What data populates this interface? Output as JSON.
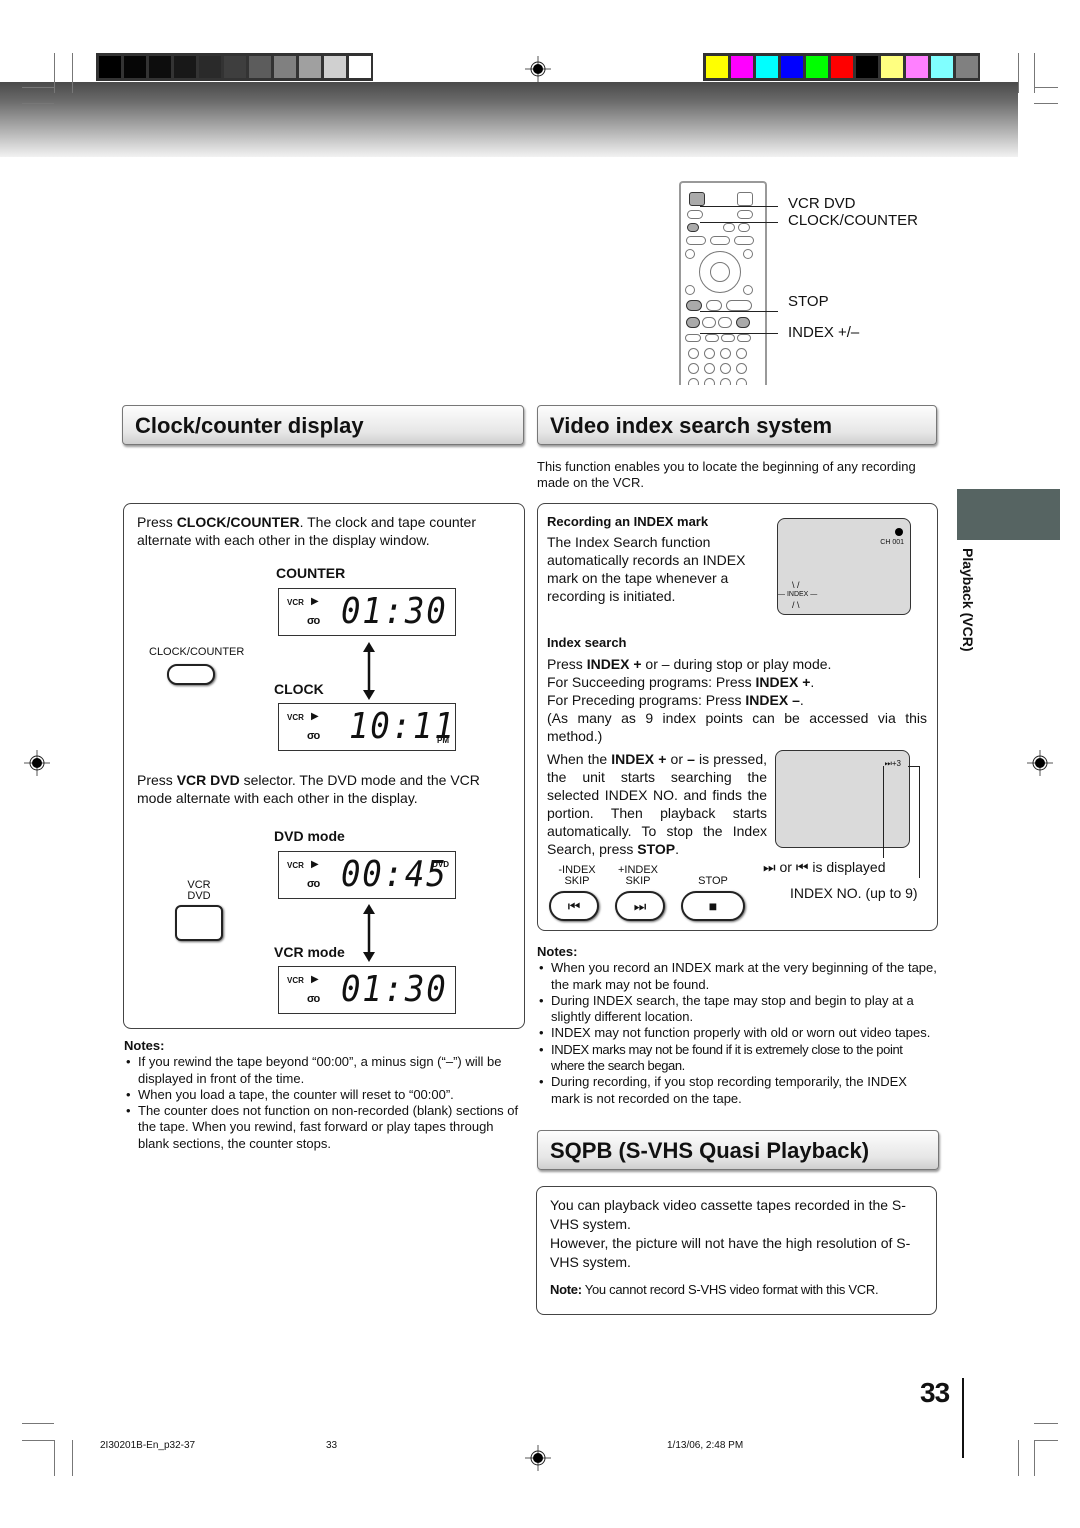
{
  "print_marks": {
    "grayscale_swatches": [
      "#000000",
      "#060606",
      "#0d0d0d",
      "#181818",
      "#2a2a2a",
      "#3e3e3e",
      "#5c5c5c",
      "#808080",
      "#a0a0a0",
      "#d0d0d0",
      "#ffffff"
    ],
    "color_swatches": [
      "#ffff00",
      "#ff00ff",
      "#00ffff",
      "#0000ff",
      "#00ff00",
      "#ff0000",
      "#000000",
      "#ffff80",
      "#ff80ff",
      "#80ffff",
      "#808080"
    ]
  },
  "remote": {
    "labels": [
      "VCR DVD",
      "CLOCK/COUNTER",
      "STOP",
      "INDEX +/–"
    ]
  },
  "clock_counter": {
    "title": "Clock/counter display",
    "intro_prefix": "Press ",
    "intro_bold": "CLOCK/COUNTER",
    "intro_suffix": ". The clock and tape counter alternate with each other in the display window.",
    "button_label": "CLOCK/COUNTER",
    "counter_label": "COUNTER",
    "clock_label": "CLOCK",
    "counter_display": {
      "source": "VCR",
      "digits": "01:30"
    },
    "clock_display": {
      "source": "VCR",
      "digits": "10:11",
      "suffix": "PM"
    },
    "selector_prefix": "Press ",
    "selector_bold": "VCR DVD",
    "selector_suffix": " selector. The DVD mode and the VCR mode alternate with each other in the display.",
    "vcrdvd_button_label_1": "VCR",
    "vcrdvd_button_label_2": "DVD",
    "dvd_mode_label": "DVD mode",
    "vcr_mode_label": "VCR mode",
    "dvd_display": {
      "source": "VCR",
      "digits": "00:45",
      "suffix": "DVD"
    },
    "vcr_display": {
      "source": "VCR",
      "digits": "01:30"
    },
    "notes_title": "Notes:",
    "notes": [
      "If you rewind the tape beyond “00:00”, a minus sign (“–”) will be displayed in front of the time.",
      "When you load a tape, the counter will reset to “00:00”.",
      "The counter does not function on non-recorded (blank) sections of the tape. When you rewind, fast forward or play tapes through blank sections, the counter stops."
    ]
  },
  "video_index": {
    "title": "Video index search system",
    "intro": "This function enables you to locate the beginning of any recording made on the VCR.",
    "recording_heading": "Recording an INDEX mark",
    "recording_text": "The Index Search function automatically records an INDEX mark on the tape whenever a recording is initiated.",
    "screen1": {
      "channel": "CH 001",
      "index_label": "INDEX"
    },
    "search_heading": "Index search",
    "search_line1_prefix": "Press ",
    "search_line1_bold": "INDEX +",
    "search_line1_suffix": " or – during stop or play mode.",
    "search_line2_prefix": "For Succeeding programs: Press ",
    "search_line2_bold": "INDEX +",
    "search_line3_prefix": "For Preceding programs: Press ",
    "search_line3_bold": "INDEX –",
    "search_line4": "(As many as 9 index points can be accessed via this method.)",
    "when_prefix": "When the ",
    "when_bold": "INDEX + ",
    "when_mid": "or ",
    "when_bold2": "–",
    "when_suffix": " is pressed, the unit starts searching the selected INDEX NO. and finds the portion. Then playback starts automatically. To stop the Index Search, press ",
    "when_bold3": "STOP",
    "screen2": {
      "index_indicator": "⏭+3"
    },
    "displayed_caption": "or ⏮ is displayed",
    "index_no_caption": "INDEX NO. (up to 9)",
    "buttons": [
      {
        "label_1": "-INDEX",
        "label_2": "SKIP",
        "glyph": "⏮"
      },
      {
        "label_1": "+INDEX",
        "label_2": "SKIP",
        "glyph": "⏭"
      },
      {
        "label_1": "",
        "label_2": "STOP",
        "glyph": "■"
      }
    ],
    "notes_title": "Notes:",
    "notes": [
      "When you record an INDEX mark at the very beginning of the tape, the mark may not be found.",
      "During INDEX search, the tape may stop and begin to play at a slightly different location.",
      "INDEX may not function properly with old or worn out video tapes.",
      "INDEX marks may not be found if it is extremely close to the point where the search began.",
      "During recording, if you stop recording temporarily, the INDEX mark is not recorded on the tape."
    ]
  },
  "sqpb": {
    "title": "SQPB (S-VHS Quasi Playback)",
    "text1": "You can playback video cassette tapes recorded in the S-VHS system.",
    "text2": "However, the picture will not have the high resolution of S-VHS system.",
    "note_bold": "Note:",
    "note_text": " You cannot record S-VHS video format with this VCR."
  },
  "side_tab": {
    "label": "Playback (VCR)",
    "color": "#566462"
  },
  "page_number": "33",
  "footer": {
    "file": "2I30201B-En_p32-37",
    "page": "33",
    "timestamp": "1/13/06, 2:48 PM"
  }
}
